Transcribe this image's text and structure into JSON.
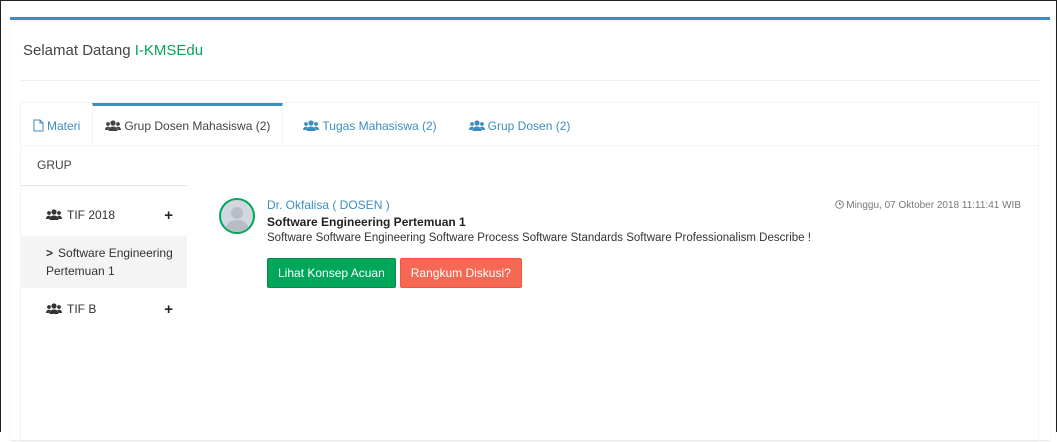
{
  "header": {
    "welcome_prefix": "Selamat Datang ",
    "brand": "I-KMSEdu"
  },
  "tabs": [
    {
      "label": "Materi",
      "icon": "file-icon"
    },
    {
      "label": "Grup Dosen Mahasiswa (2)",
      "icon": "users-icon"
    },
    {
      "label": "Tugas Mahasiswa (2)",
      "icon": "users-icon"
    },
    {
      "label": "Grup Dosen (2)",
      "icon": "users-icon"
    }
  ],
  "sidebar": {
    "header": "GRUP",
    "groups": [
      {
        "label": "TIF 2018",
        "add": "+"
      },
      {
        "label": "TIF B",
        "add": "+"
      }
    ],
    "sub_item": {
      "chevron": ">",
      "label": "Software Engineering Pertemuan 1"
    }
  },
  "post": {
    "author": "Dr. Okfalisa ( DOSEN )",
    "title": "Software Engineering Pertemuan 1",
    "description": "Software Software Engineering Software Process Software Standards Software Professionalism Describe !",
    "timestamp": "Minggu, 07 Oktober 2018 11:11:41 WIB",
    "buttons": {
      "primary": "Lihat Konsep Acuan",
      "secondary": "Rangkum Diskusi?"
    }
  },
  "colors": {
    "accent": "#3c8dbc",
    "success": "#00a65a",
    "danger": "#f56954"
  }
}
